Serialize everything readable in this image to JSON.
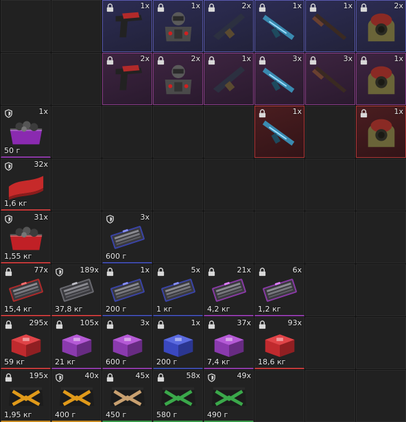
{
  "colors": {
    "rarity_blue": "#5a5ab0",
    "rarity_purple": "#8a3f8a",
    "rarity_red": "#b03a3a"
  },
  "inventory": {
    "rows": [
      [
        {
          "empty": true
        },
        {
          "empty": true
        },
        {
          "item": "pistol",
          "tag": "lock",
          "count": "1x",
          "rarity": "blue"
        },
        {
          "item": "armor",
          "tag": "lock",
          "count": "1x",
          "rarity": "blue"
        },
        {
          "item": "launcher",
          "tag": "lock",
          "count": "2x",
          "rarity": "blue"
        },
        {
          "item": "rifle-blue",
          "tag": "lock",
          "count": "1x",
          "rarity": "blue"
        },
        {
          "item": "shotgun",
          "tag": "lock",
          "count": "1x",
          "rarity": "blue"
        },
        {
          "item": "hazmat",
          "tag": "lock",
          "count": "2x",
          "rarity": "blue"
        }
      ],
      [
        {
          "empty": true
        },
        {
          "empty": true
        },
        {
          "item": "pistol",
          "tag": "lock",
          "count": "2x",
          "rarity": "purple"
        },
        {
          "item": "armor",
          "tag": "lock",
          "count": "2x",
          "rarity": "purple"
        },
        {
          "item": "launcher",
          "tag": "lock",
          "count": "1x",
          "rarity": "purple"
        },
        {
          "item": "rifle-blue",
          "tag": "lock",
          "count": "3x",
          "rarity": "purple"
        },
        {
          "item": "shotgun",
          "tag": "lock",
          "count": "3x",
          "rarity": "purple"
        },
        {
          "item": "hazmat",
          "tag": "lock",
          "count": "1x",
          "rarity": "purple"
        }
      ],
      [
        {
          "item": "crate-purple",
          "tag": "shield",
          "count": "1x",
          "weight": "50 г",
          "line": "purple"
        },
        {
          "empty": true
        },
        {
          "empty": true
        },
        {
          "empty": true
        },
        {
          "empty": true
        },
        {
          "item": "rifle-blue",
          "tag": "lock",
          "count": "1x",
          "rarity": "red"
        },
        {
          "empty": true
        },
        {
          "item": "hazmat",
          "tag": "lock",
          "count": "1x",
          "rarity": "red"
        }
      ],
      [
        {
          "item": "cloth",
          "tag": "shield",
          "count": "32x",
          "weight": "1,6 кг",
          "line": "red"
        },
        {
          "empty": true
        },
        {
          "empty": true
        },
        {
          "empty": true
        },
        {
          "empty": true
        },
        {
          "empty": true
        },
        {
          "empty": true
        },
        {
          "empty": true
        }
      ],
      [
        {
          "item": "crate-red",
          "tag": "shield",
          "count": "31x",
          "weight": "1,55 кг",
          "line": "red"
        },
        {
          "empty": true
        },
        {
          "item": "ammo-blue",
          "tag": "shield",
          "count": "3x",
          "weight": "600 г",
          "line": "blue"
        },
        {
          "empty": true
        },
        {
          "empty": true
        },
        {
          "empty": true
        },
        {
          "empty": true
        },
        {
          "empty": true
        }
      ],
      [
        {
          "item": "ammo-red",
          "tag": "lock",
          "count": "77x",
          "weight": "15,4 кг",
          "line": "red"
        },
        {
          "item": "ammo-grey",
          "tag": "shield",
          "count": "189x",
          "weight": "37,8 кг",
          "line": "red"
        },
        {
          "item": "ammo-blue",
          "tag": "lock",
          "count": "1x",
          "weight": "200 г",
          "line": "blue"
        },
        {
          "item": "ammo-blue",
          "tag": "lock",
          "count": "5x",
          "weight": "1 кг",
          "line": "blue"
        },
        {
          "item": "ammo-purple",
          "tag": "lock",
          "count": "21x",
          "weight": "4,2 кг",
          "line": "purple"
        },
        {
          "item": "ammo-purple",
          "tag": "lock",
          "count": "6x",
          "weight": "1,2 кг",
          "line": "purple"
        },
        {
          "empty": true
        },
        {
          "empty": true
        }
      ],
      [
        {
          "item": "box-red",
          "tag": "lock",
          "count": "295x",
          "weight": "59 кг",
          "line": "red"
        },
        {
          "item": "box-purple",
          "tag": "lock",
          "count": "105x",
          "weight": "21 кг",
          "line": "purple"
        },
        {
          "item": "box-purple",
          "tag": "lock",
          "count": "3x",
          "weight": "600 г",
          "line": "purple"
        },
        {
          "item": "box-blue",
          "tag": "lock",
          "count": "1x",
          "weight": "200 г",
          "line": "blue"
        },
        {
          "item": "box-purple",
          "tag": "lock",
          "count": "37x",
          "weight": "7,4 кг",
          "line": "purple"
        },
        {
          "item": "box-red",
          "tag": "lock",
          "count": "93x",
          "weight": "18,6 кг",
          "line": "red"
        },
        {
          "empty": true
        },
        {
          "empty": true
        }
      ],
      [
        {
          "item": "case-orange",
          "tag": "lock",
          "count": "195x",
          "weight": "1,95 кг",
          "line": "orange"
        },
        {
          "item": "case-orange",
          "tag": "shield",
          "count": "40x",
          "weight": "400 г",
          "line": "orange"
        },
        {
          "item": "case-tan",
          "tag": "lock",
          "count": "45x",
          "weight": "450 г",
          "line": "green"
        },
        {
          "item": "case-green",
          "tag": "lock",
          "count": "58x",
          "weight": "580 г",
          "line": "green"
        },
        {
          "item": "case-green",
          "tag": "shield",
          "count": "49x",
          "weight": "490 г",
          "line": "green"
        },
        {
          "empty": true
        },
        {
          "empty": true
        },
        {
          "empty": true
        }
      ]
    ]
  }
}
